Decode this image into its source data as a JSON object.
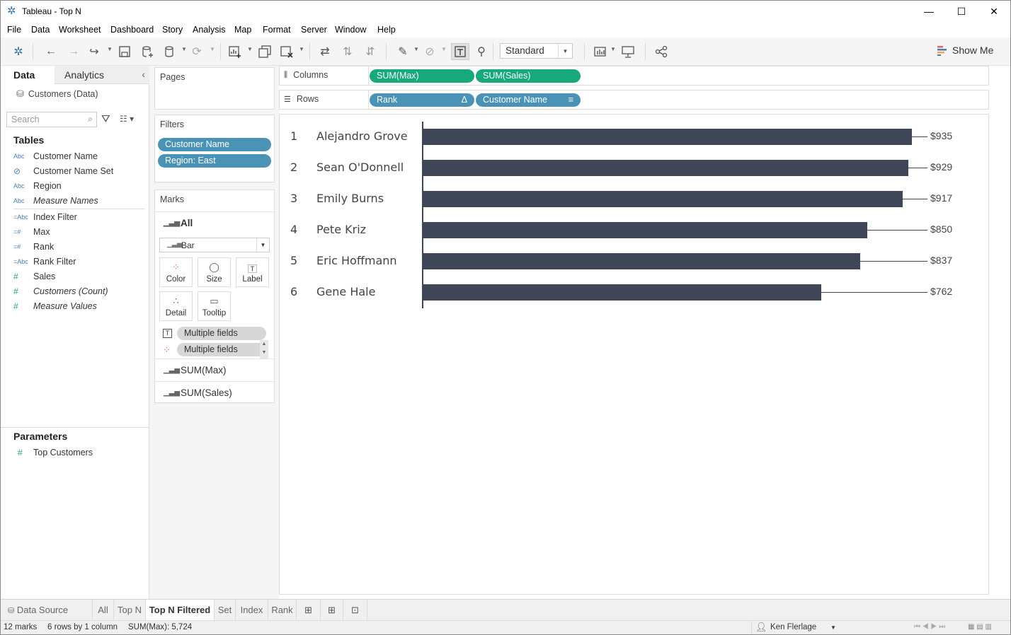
{
  "window": {
    "title": "Tableau - Top N",
    "minimize": "—",
    "maximize": "☐",
    "close": "✕"
  },
  "menu": [
    "File",
    "Data",
    "Worksheet",
    "Dashboard",
    "Story",
    "Analysis",
    "Map",
    "Format",
    "Server",
    "Window",
    "Help"
  ],
  "toolbar": {
    "fit": "Standard",
    "show_me": "Show Me"
  },
  "data_pane": {
    "tab_data": "Data",
    "tab_analytics": "Analytics",
    "datasource": "Customers (Data)",
    "search_placeholder": "Search",
    "tables_header": "Tables",
    "fields": [
      {
        "icon": "Abc",
        "name": "Customer Name"
      },
      {
        "icon": "⊘",
        "name": "Customer Name Set"
      },
      {
        "icon": "Abc",
        "name": "Region"
      },
      {
        "icon": "Abc",
        "name": "Measure Names"
      },
      {
        "icon": "=Abc",
        "name": "Index Filter"
      },
      {
        "icon": "=#",
        "name": "Max"
      },
      {
        "icon": "=#",
        "name": "Rank"
      },
      {
        "icon": "=Abc",
        "name": "Rank Filter"
      },
      {
        "icon": "#",
        "name": "Sales"
      },
      {
        "icon": "#",
        "name": "Customers (Count)"
      },
      {
        "icon": "#",
        "name": "Measure Values"
      }
    ],
    "parameters_header": "Parameters",
    "parameters": [
      {
        "icon": "#",
        "name": "Top Customers"
      }
    ]
  },
  "pages": {
    "header": "Pages"
  },
  "filters": {
    "header": "Filters",
    "items": [
      "Customer Name",
      "Region: East"
    ]
  },
  "marks": {
    "header": "Marks",
    "all": "All",
    "type": "Bar",
    "buttons": [
      "Color",
      "Size",
      "Label",
      "Detail",
      "Tooltip"
    ],
    "fields": [
      "Multiple fields",
      "Multiple fields"
    ],
    "measures": [
      "SUM(Max)",
      "SUM(Sales)"
    ]
  },
  "columns": {
    "label": "Columns",
    "pills": [
      "SUM(Max)",
      "SUM(Sales)"
    ]
  },
  "rows": {
    "label": "Rows",
    "pills": [
      "Rank",
      "Customer Name"
    ]
  },
  "chart_data": {
    "type": "bar",
    "categories": [
      "Alejandro Grove",
      "Sean O'Donnell",
      "Emily Burns",
      "Pete Kriz",
      "Eric Hoffmann",
      "Gene Hale"
    ],
    "ranks": [
      "1",
      "2",
      "3",
      "4",
      "5",
      "6"
    ],
    "series": [
      {
        "name": "SUM(Sales)",
        "values": [
          935,
          929,
          917,
          850,
          837,
          762
        ]
      }
    ],
    "labels": [
      "$935",
      "$929",
      "$917",
      "$850",
      "$837",
      "$762"
    ],
    "xlim": [
      0,
      940
    ]
  },
  "sheets": {
    "datasource": "Data Source",
    "tabs": [
      "All",
      "Top N",
      "Top N Filtered",
      "Set",
      "Index",
      "Rank"
    ],
    "active": "Top N Filtered"
  },
  "status": {
    "marks": "12 marks",
    "rows": "6 rows by 1 column",
    "sum": "SUM(Max): 5,724",
    "user": "Ken Flerlage"
  }
}
